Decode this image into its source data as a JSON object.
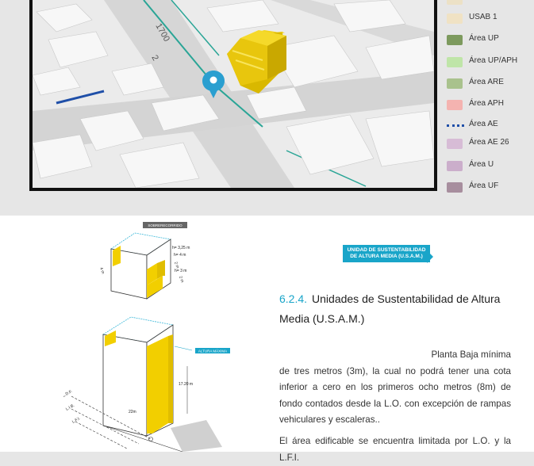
{
  "map": {
    "street_labels": [
      "1700",
      "2"
    ]
  },
  "legend": {
    "items": [
      {
        "label": "",
        "color": "#ece1c6",
        "style": "swatch"
      },
      {
        "label": "USAB 1",
        "color": "#f0e2c4",
        "style": "swatch"
      },
      {
        "label": "Área UP",
        "color": "#7d9a5e",
        "style": "swatch"
      },
      {
        "label": "Área UP/APH",
        "color": "#bfe5a8",
        "style": "swatch"
      },
      {
        "label": "Área ARE",
        "color": "#a9c28d",
        "style": "swatch"
      },
      {
        "label": "Área APH",
        "color": "#f4b3b0",
        "style": "swatch"
      },
      {
        "label": "Área AE",
        "color": "#1f4fa8",
        "style": "dots"
      },
      {
        "label": "Área AE 26",
        "color": "#d7bcd6",
        "style": "swatch"
      },
      {
        "label": "Área U",
        "color": "#cbaecb",
        "style": "swatch"
      },
      {
        "label": "Área UF",
        "color": "#a78e9e",
        "style": "swatch"
      }
    ]
  },
  "diagram": {
    "top_tag": "SOBRERECORRIDO",
    "dim_h1": "h= 3,25 m",
    "dim_h2": "h= 4 m",
    "dim_h3": "h= 3 m",
    "dim_d1": "4 m",
    "dim_d2": "2 m",
    "dim_d3": "2 m",
    "max_tag": "ALTURA MÁXIMA",
    "height_dim": "17.20 m",
    "depth_dim": "22m",
    "lines": [
      "L.D.F.",
      "L.I.B.",
      "L.F.I."
    ]
  },
  "badge": {
    "text": "UNIDAD DE SUSTENTABILIDAD DE ALTURA MEDIA (U.S.A.M.)"
  },
  "section": {
    "number": "6.2.4.",
    "title": "Unidades de Sustentabilidad de Altura Media (U.S.A.M.)"
  },
  "body": {
    "p1_first": "Planta Baja mínima",
    "p1_rest": "de tres metros (3m), la cual no podrá tener una cota inferior a cero en los primeros ocho metros (8m) de fondo contados desde la L.O. con excepción de rampas vehiculares y escaleras..",
    "p2": "El área edificable se encuentra limitada por L.O. y la L.F.I."
  }
}
